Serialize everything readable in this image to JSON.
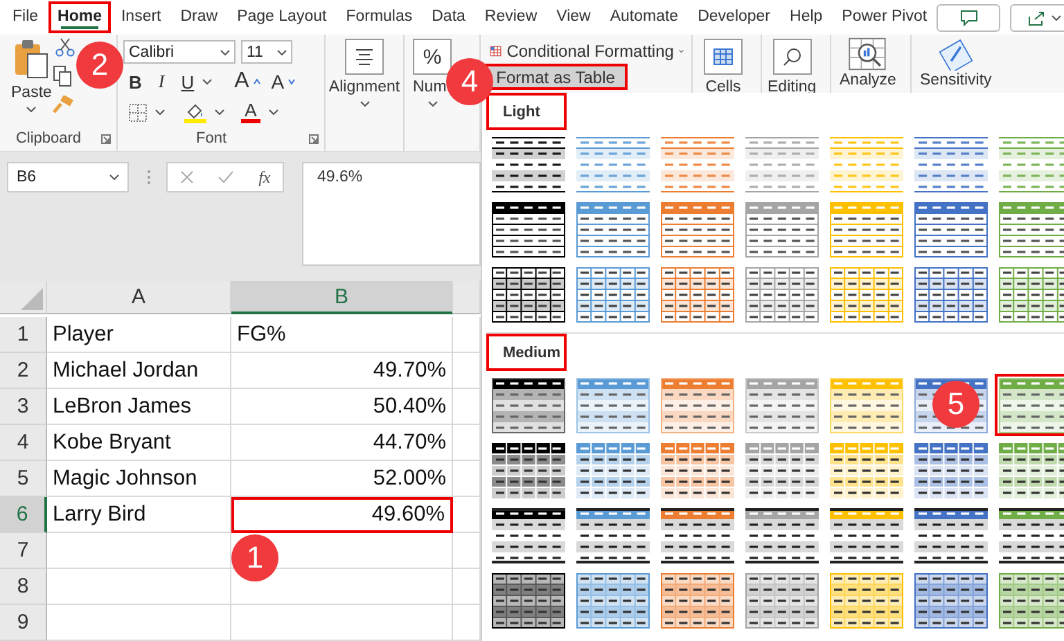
{
  "tabs": [
    {
      "label": "File",
      "selected": false,
      "highlighted": false
    },
    {
      "label": "Home",
      "selected": true,
      "highlighted": true
    },
    {
      "label": "Insert",
      "selected": false,
      "highlighted": false
    },
    {
      "label": "Draw",
      "selected": false,
      "highlighted": false
    },
    {
      "label": "Page Layout",
      "selected": false,
      "highlighted": false
    },
    {
      "label": "Formulas",
      "selected": false,
      "highlighted": false
    },
    {
      "label": "Data",
      "selected": false,
      "highlighted": false
    },
    {
      "label": "Review",
      "selected": false,
      "highlighted": false
    },
    {
      "label": "View",
      "selected": false,
      "highlighted": false
    },
    {
      "label": "Automate",
      "selected": false,
      "highlighted": false
    },
    {
      "label": "Developer",
      "selected": false,
      "highlighted": false
    },
    {
      "label": "Help",
      "selected": false,
      "highlighted": false
    },
    {
      "label": "Power Pivot",
      "selected": false,
      "highlighted": false
    }
  ],
  "ribbon": {
    "clipboard": {
      "paste": "Paste",
      "label": "Clipboard"
    },
    "font": {
      "name": "Calibri",
      "size": "11",
      "bold": "B",
      "italic": "I",
      "underline": "U",
      "grow": "A",
      "shrink": "A",
      "font_color": "A",
      "label": "Font"
    },
    "alignment": {
      "label": "Alignment"
    },
    "number": {
      "icon": "%",
      "label": "Num"
    },
    "styles": {
      "conditional_formatting": "Conditional Formatting",
      "format_as_table": {
        "label": "Format as Table",
        "highlighted": true
      }
    },
    "cells": "Cells",
    "editing": "Editing",
    "analyze": "Analyze",
    "sensitivity": "Sensitivity"
  },
  "formula_bar": {
    "name_box": "B6",
    "fx": "fx",
    "value": "49.6%"
  },
  "sheet": {
    "columns": [
      {
        "label": "A",
        "selected": false
      },
      {
        "label": "B",
        "selected": true
      }
    ],
    "rows": [
      {
        "number": "1",
        "selected": false,
        "cells": [
          {
            "value": "Player",
            "kind": "text",
            "highlighted": false
          },
          {
            "value": "FG%",
            "kind": "text",
            "highlighted": false
          }
        ]
      },
      {
        "number": "2",
        "selected": false,
        "cells": [
          {
            "value": "Michael Jordan",
            "kind": "text",
            "highlighted": false
          },
          {
            "value": "49.70%",
            "kind": "number",
            "highlighted": false
          }
        ]
      },
      {
        "number": "3",
        "selected": false,
        "cells": [
          {
            "value": "LeBron James",
            "kind": "text",
            "highlighted": false
          },
          {
            "value": "50.40%",
            "kind": "number",
            "highlighted": false
          }
        ]
      },
      {
        "number": "4",
        "selected": false,
        "cells": [
          {
            "value": "Kobe Bryant",
            "kind": "text",
            "highlighted": false
          },
          {
            "value": "44.70%",
            "kind": "number",
            "highlighted": false
          }
        ]
      },
      {
        "number": "5",
        "selected": false,
        "cells": [
          {
            "value": "Magic Johnson",
            "kind": "text",
            "highlighted": false
          },
          {
            "value": "52.00%",
            "kind": "number",
            "highlighted": false
          }
        ]
      },
      {
        "number": "6",
        "selected": true,
        "cells": [
          {
            "value": "Larry Bird",
            "kind": "text",
            "highlighted": false
          },
          {
            "value": "49.60%",
            "kind": "number",
            "highlighted": true
          }
        ]
      },
      {
        "number": "7",
        "selected": false
      },
      {
        "number": "8",
        "selected": false
      },
      {
        "number": "9",
        "selected": false
      }
    ]
  },
  "gallery": {
    "sections": [
      {
        "label": "Light",
        "highlighted": true,
        "rows": [
          {
            "kind": "banded",
            "items": [
              {
                "color": "#000000",
                "highlighted": false
              },
              {
                "color": "#5b9bd5",
                "highlighted": false
              },
              {
                "color": "#ed7d31",
                "highlighted": false
              },
              {
                "color": "#a5a5a5",
                "highlighted": false
              },
              {
                "color": "#ffc000",
                "highlighted": false
              },
              {
                "color": "#4472c4",
                "highlighted": false
              },
              {
                "color": "#70ad47",
                "highlighted": false
              }
            ]
          },
          {
            "kind": "header-bordered",
            "items": [
              {
                "color": "#000000",
                "highlighted": false
              },
              {
                "color": "#5b9bd5",
                "highlighted": false
              },
              {
                "color": "#ed7d31",
                "highlighted": false
              },
              {
                "color": "#a5a5a5",
                "highlighted": false
              },
              {
                "color": "#ffc000",
                "highlighted": false
              },
              {
                "color": "#4472c4",
                "highlighted": false
              },
              {
                "color": "#70ad47",
                "highlighted": false
              }
            ]
          },
          {
            "kind": "grid",
            "items": [
              {
                "color": "#000000",
                "highlighted": false
              },
              {
                "color": "#5b9bd5",
                "highlighted": false
              },
              {
                "color": "#ed7d31",
                "highlighted": false
              },
              {
                "color": "#a5a5a5",
                "highlighted": false
              },
              {
                "color": "#ffc000",
                "highlighted": false
              },
              {
                "color": "#4472c4",
                "highlighted": false
              },
              {
                "color": "#70ad47",
                "highlighted": false
              }
            ]
          }
        ]
      },
      {
        "label": "Medium",
        "highlighted": true,
        "rows": [
          {
            "kind": "header-banded",
            "items": [
              {
                "color": "#000000",
                "highlighted": false
              },
              {
                "color": "#5b9bd5",
                "highlighted": false
              },
              {
                "color": "#ed7d31",
                "highlighted": false
              },
              {
                "color": "#a5a5a5",
                "highlighted": false
              },
              {
                "color": "#ffc000",
                "highlighted": false
              },
              {
                "color": "#4472c4",
                "highlighted": false
              },
              {
                "color": "#70ad47",
                "highlighted": true
              }
            ]
          },
          {
            "kind": "header-grid",
            "items": [
              {
                "color": "#000000",
                "highlighted": false
              },
              {
                "color": "#5b9bd5",
                "highlighted": false
              },
              {
                "color": "#ed7d31",
                "highlighted": false
              },
              {
                "color": "#a5a5a5",
                "highlighted": false
              },
              {
                "color": "#ffc000",
                "highlighted": false
              },
              {
                "color": "#4472c4",
                "highlighted": false
              },
              {
                "color": "#70ad47",
                "highlighted": false
              }
            ]
          },
          {
            "kind": "header-lines",
            "items": [
              {
                "color": "#000000",
                "highlighted": false
              },
              {
                "color": "#5b9bd5",
                "highlighted": false
              },
              {
                "color": "#ed7d31",
                "highlighted": false
              },
              {
                "color": "#a5a5a5",
                "highlighted": false
              },
              {
                "color": "#ffc000",
                "highlighted": false
              },
              {
                "color": "#4472c4",
                "highlighted": false
              },
              {
                "color": "#70ad47",
                "highlighted": false
              }
            ]
          },
          {
            "kind": "grid-tinted",
            "items": [
              {
                "color": "#000000",
                "highlighted": false
              },
              {
                "color": "#5b9bd5",
                "highlighted": false
              },
              {
                "color": "#ed7d31",
                "highlighted": false
              },
              {
                "color": "#a5a5a5",
                "highlighted": false
              },
              {
                "color": "#ffc000",
                "highlighted": false
              },
              {
                "color": "#4472c4",
                "highlighted": false
              },
              {
                "color": "#70ad47",
                "highlighted": false
              }
            ]
          }
        ]
      }
    ]
  },
  "badges": [
    {
      "text": "1"
    },
    {
      "text": "2"
    },
    {
      "text": "4"
    },
    {
      "text": "5"
    }
  ]
}
